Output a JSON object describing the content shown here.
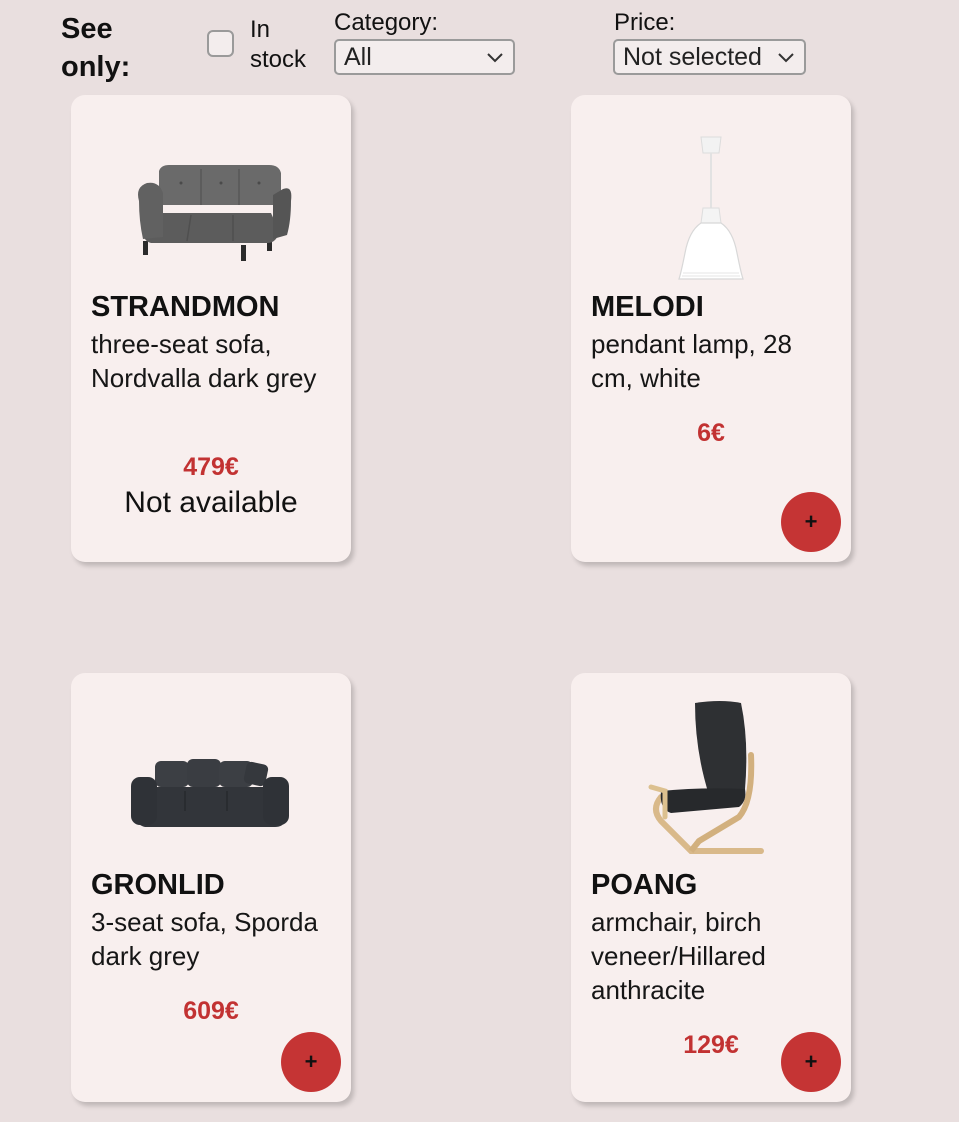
{
  "filters": {
    "see_only_label": "See only:",
    "in_stock_label": "In stock",
    "category_label": "Category:",
    "category_value": "All",
    "price_label": "Price:",
    "price_value": "Not selected"
  },
  "products": [
    {
      "name": "STRANDMON",
      "description": "three-seat sofa, Nordvalla dark grey",
      "price": "479€",
      "availability": "Not available",
      "image": "wingback-sofa-image"
    },
    {
      "name": "MELODI",
      "description": "pendant lamp, 28 cm, white",
      "price": "6€",
      "add_label": "+",
      "image": "pendant-lamp-image"
    },
    {
      "name": "GRONLID",
      "description": "3-seat sofa, Sporda dark grey",
      "price": "609€",
      "add_label": "+",
      "image": "three-seat-sofa-image"
    },
    {
      "name": "POANG",
      "description": "armchair, birch veneer/Hillared anthracite",
      "price": "129€",
      "add_label": "+",
      "image": "armchair-image"
    }
  ],
  "colors": {
    "background": "#e9dfdf",
    "card": "#f8efee",
    "price": "#c23232",
    "add_button": "#c53434"
  }
}
